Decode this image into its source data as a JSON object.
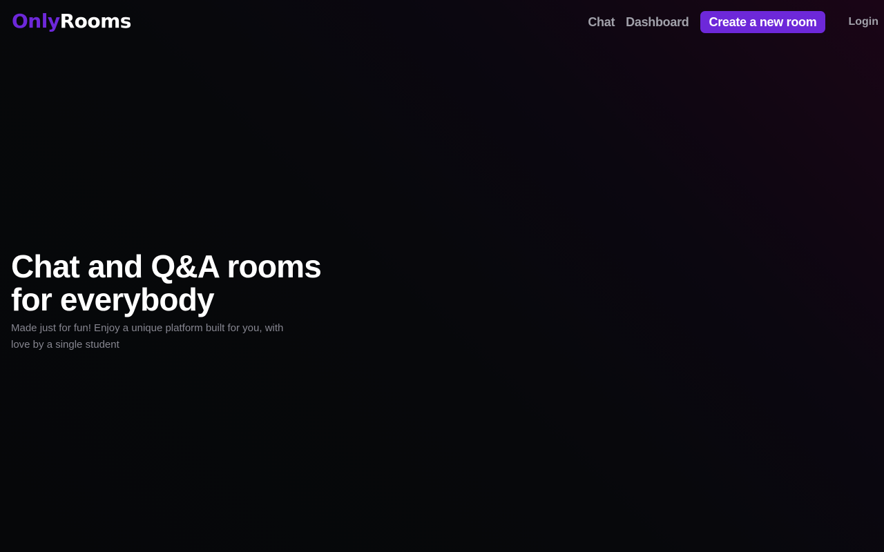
{
  "brand": {
    "logo_part1": "Only",
    "logo_part2": "Rooms",
    "accent_color": "#6d28d9"
  },
  "nav": {
    "chat": "Chat",
    "dashboard": "Dashboard",
    "create_room": "Create a new room",
    "login": "Login"
  },
  "hero": {
    "title": "Chat and Q&A rooms for everybody",
    "subtitle": "Made just for fun! Enjoy a unique platform built for you, with love by a single student"
  }
}
